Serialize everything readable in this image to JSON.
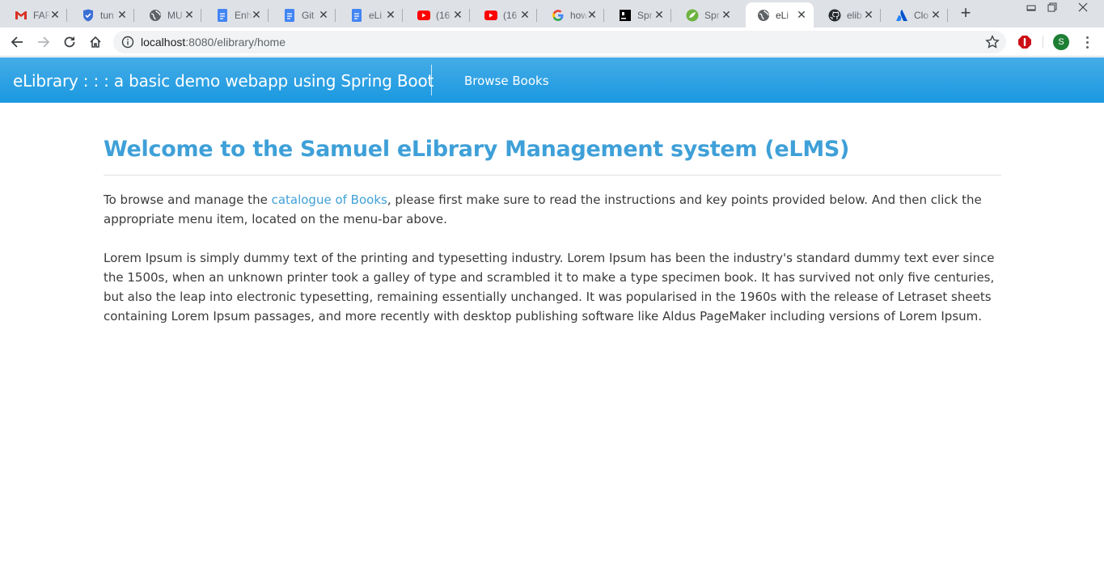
{
  "browser": {
    "tabs": [
      {
        "title": "FAF",
        "icon": "gmail-icon"
      },
      {
        "title": "tun",
        "icon": "shield-icon"
      },
      {
        "title": "MU",
        "icon": "globe-icon"
      },
      {
        "title": "Enh",
        "icon": "docs-icon"
      },
      {
        "title": "Git",
        "icon": "docs-icon"
      },
      {
        "title": "eLi",
        "icon": "docs-icon"
      },
      {
        "title": "(16",
        "icon": "youtube-icon"
      },
      {
        "title": "(16",
        "icon": "youtube-icon"
      },
      {
        "title": "how",
        "icon": "google-icon"
      },
      {
        "title": "Spr",
        "icon": "jetbrains-icon"
      },
      {
        "title": "Spr",
        "icon": "spring-icon"
      },
      {
        "title": "eLi",
        "icon": "globe-icon",
        "active": true
      },
      {
        "title": "elib",
        "icon": "github-icon"
      },
      {
        "title": "Clo",
        "icon": "atlassian-icon"
      }
    ],
    "address": {
      "host": "localhost",
      "path": ":8080/elibrary/home"
    },
    "profile_initial": "S",
    "colors": {
      "tabstrip": "#dee1e6",
      "omnibox": "#f1f3f4"
    }
  },
  "site": {
    "brand": "eLibrary : : : a basic demo webapp using Spring Boot",
    "nav": {
      "browse_books": "Browse Books"
    },
    "colors": {
      "header_top": "#45ace7",
      "header_bottom": "#1a98e0",
      "title": "#3fa0d8",
      "link": "#3fa0d8"
    }
  },
  "main": {
    "title": "Welcome to the Samuel eLibrary Management system (eLMS)",
    "intro_before_link": "To browse and manage the ",
    "intro_link": "catalogue of Books",
    "intro_after_link": ", please first make sure to read the instructions and key points provided below. And then click the appropriate menu item, located on the menu-bar above.",
    "lorem": "Lorem Ipsum is simply dummy text of the printing and typesetting industry. Lorem Ipsum has been the industry's standard dummy text ever since the 1500s, when an unknown printer took a galley of type and scrambled it to make a type specimen book. It has survived not only five centuries, but also the leap into electronic typesetting, remaining essentially unchanged. It was popularised in the 1960s with the release of Letraset sheets containing Lorem Ipsum passages, and more recently with desktop publishing software like Aldus PageMaker including versions of Lorem Ipsum."
  }
}
